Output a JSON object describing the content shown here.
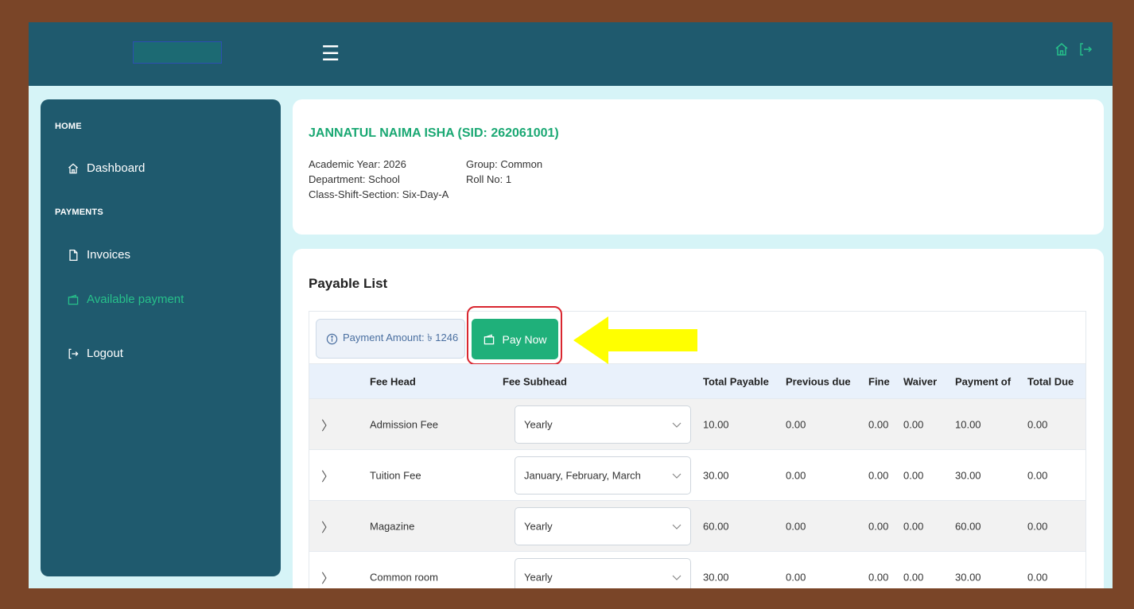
{
  "header": {
    "menu_icon": "hamburger-icon",
    "right_icons": [
      "home-icon",
      "logout-icon"
    ]
  },
  "sidebar": {
    "sections": [
      {
        "title": "HOME",
        "items": [
          {
            "label": "Dashboard",
            "icon": "home-icon"
          }
        ]
      },
      {
        "title": "PAYMENTS",
        "items": [
          {
            "label": "Invoices",
            "icon": "file-icon"
          },
          {
            "label": "Available payment",
            "icon": "wallet-icon",
            "active": true
          },
          {
            "label": "Logout",
            "icon": "logout-icon"
          }
        ]
      }
    ]
  },
  "student": {
    "name": "JANNATUL NAIMA ISHA (SID: 262061001)",
    "academic_year": "Academic Year: 2026",
    "department": "Department: School",
    "class_shift_section": "Class-Shift-Section: Six-Day-A",
    "group": "Group: Common",
    "roll": "Roll No: 1"
  },
  "payable": {
    "title": "Payable List",
    "payment_amount": "Payment Amount: ৳ 1246",
    "pay_now_label": "Pay Now",
    "columns": [
      "Fee Head",
      "Fee Subhead",
      "Total Payable",
      "Previous due",
      "Fine",
      "Waiver",
      "Payment of",
      "Total Due"
    ],
    "rows": [
      {
        "fee_head": "Admission Fee",
        "fee_subhead": "Yearly",
        "total_payable": "10.00",
        "previous_due": "0.00",
        "fine": "0.00",
        "waiver": "0.00",
        "payment_of": "10.00",
        "total_due": "0.00"
      },
      {
        "fee_head": "Tuition Fee",
        "fee_subhead": "January, February, March",
        "total_payable": "30.00",
        "previous_due": "0.00",
        "fine": "0.00",
        "waiver": "0.00",
        "payment_of": "30.00",
        "total_due": "0.00"
      },
      {
        "fee_head": "Magazine",
        "fee_subhead": "Yearly",
        "total_payable": "60.00",
        "previous_due": "0.00",
        "fine": "0.00",
        "waiver": "0.00",
        "payment_of": "60.00",
        "total_due": "0.00"
      },
      {
        "fee_head": "Common room",
        "fee_subhead": "Yearly",
        "total_payable": "30.00",
        "previous_due": "0.00",
        "fine": "0.00",
        "waiver": "0.00",
        "payment_of": "30.00",
        "total_due": "0.00"
      }
    ]
  },
  "colors": {
    "brand_dark": "#1f5a6e",
    "accent_green": "#1fb07a",
    "highlight_red": "#d9262f",
    "arrow_yellow": "#ffff00"
  }
}
